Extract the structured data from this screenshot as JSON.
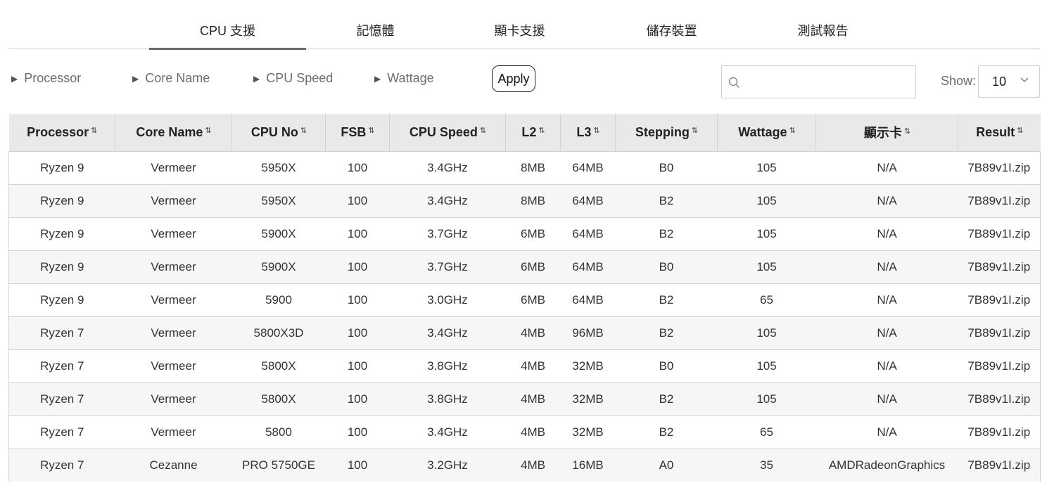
{
  "tabs": [
    {
      "label": "CPU 支援",
      "active": true
    },
    {
      "label": "記憶體",
      "active": false
    },
    {
      "label": "顯卡支援",
      "active": false
    },
    {
      "label": "儲存裝置",
      "active": false
    },
    {
      "label": "測試報告",
      "active": false
    }
  ],
  "filters": {
    "processor": "Processor",
    "core_name": "Core Name",
    "cpu_speed": "CPU Speed",
    "wattage": "Wattage",
    "apply_label": "Apply"
  },
  "search": {
    "value": "",
    "placeholder": "",
    "icon": "search-icon"
  },
  "show": {
    "label": "Show:",
    "value": "10"
  },
  "table": {
    "columns": [
      "Processor",
      "Core Name",
      "CPU No",
      "FSB",
      "CPU Speed",
      "L2",
      "L3",
      "Stepping",
      "Wattage",
      "顯示卡",
      "Result"
    ],
    "sort_icon": "⇅",
    "rows": [
      [
        "Ryzen 9",
        "Vermeer",
        "5950X",
        "100",
        "3.4GHz",
        "8MB",
        "64MB",
        "B0",
        "105",
        "N/A",
        "7B89v1I.zip"
      ],
      [
        "Ryzen 9",
        "Vermeer",
        "5950X",
        "100",
        "3.4GHz",
        "8MB",
        "64MB",
        "B2",
        "105",
        "N/A",
        "7B89v1I.zip"
      ],
      [
        "Ryzen 9",
        "Vermeer",
        "5900X",
        "100",
        "3.7GHz",
        "6MB",
        "64MB",
        "B2",
        "105",
        "N/A",
        "7B89v1I.zip"
      ],
      [
        "Ryzen 9",
        "Vermeer",
        "5900X",
        "100",
        "3.7GHz",
        "6MB",
        "64MB",
        "B0",
        "105",
        "N/A",
        "7B89v1I.zip"
      ],
      [
        "Ryzen 9",
        "Vermeer",
        "5900",
        "100",
        "3.0GHz",
        "6MB",
        "64MB",
        "B2",
        "65",
        "N/A",
        "7B89v1I.zip"
      ],
      [
        "Ryzen 7",
        "Vermeer",
        "5800X3D",
        "100",
        "3.4GHz",
        "4MB",
        "96MB",
        "B2",
        "105",
        "N/A",
        "7B89v1I.zip"
      ],
      [
        "Ryzen 7",
        "Vermeer",
        "5800X",
        "100",
        "3.8GHz",
        "4MB",
        "32MB",
        "B0",
        "105",
        "N/A",
        "7B89v1I.zip"
      ],
      [
        "Ryzen 7",
        "Vermeer",
        "5800X",
        "100",
        "3.8GHz",
        "4MB",
        "32MB",
        "B2",
        "105",
        "N/A",
        "7B89v1I.zip"
      ],
      [
        "Ryzen 7",
        "Vermeer",
        "5800",
        "100",
        "3.4GHz",
        "4MB",
        "32MB",
        "B2",
        "65",
        "N/A",
        "7B89v1I.zip"
      ],
      [
        "Ryzen 7",
        "Cezanne",
        "PRO 5750GE",
        "100",
        "3.2GHz",
        "4MB",
        "16MB",
        "A0",
        "35",
        "AMDRadeonGraphics",
        "7B89v1I.zip"
      ]
    ]
  }
}
